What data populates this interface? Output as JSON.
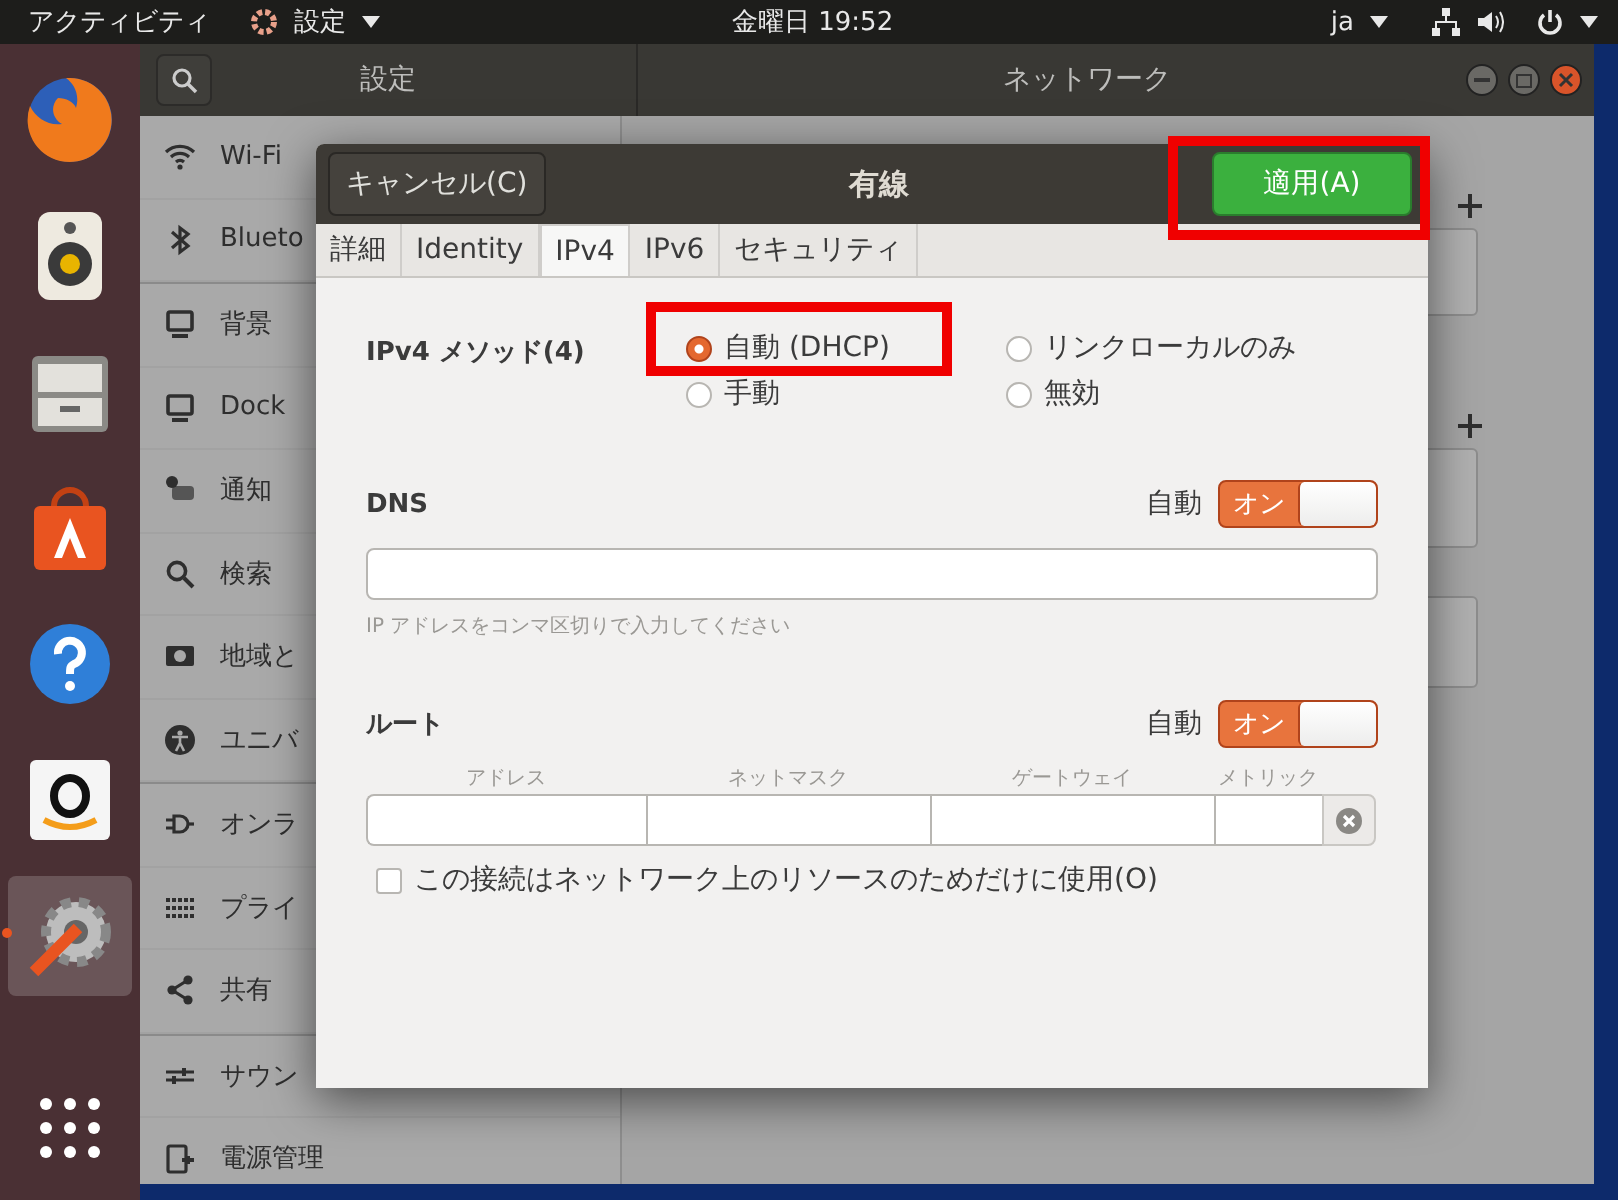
{
  "top_bar": {
    "activities": "アクティビティ",
    "app_menu": "設定",
    "clock": "金曜日 19:52",
    "input_method": "ja"
  },
  "dock": [
    {
      "kind": "firefox",
      "selected": false
    },
    {
      "kind": "speaker",
      "selected": false
    },
    {
      "kind": "files",
      "selected": false
    },
    {
      "kind": "store",
      "selected": false
    },
    {
      "kind": "help",
      "selected": false
    },
    {
      "kind": "amazon",
      "selected": false
    },
    {
      "kind": "settings",
      "selected": true
    },
    {
      "kind": "grid",
      "selected": false
    }
  ],
  "settings_window": {
    "title": "設定",
    "panel_title": "ネットワーク",
    "sidebar": [
      [
        {
          "kind": "wifi",
          "label": "Wi-Fi"
        },
        {
          "kind": "bluetooth",
          "label": "Blueto"
        }
      ],
      [
        {
          "kind": "monitor",
          "label": "背景"
        },
        {
          "kind": "monitor",
          "label": "Dock"
        },
        {
          "kind": "bell",
          "label": "通知"
        },
        {
          "kind": "search",
          "label": "検索"
        },
        {
          "kind": "camera",
          "label": "地域と"
        },
        {
          "kind": "person",
          "label": "ユニバ"
        }
      ],
      [
        {
          "kind": "plug",
          "label": "オンラ"
        },
        {
          "kind": "dots",
          "label": "プライ"
        },
        {
          "kind": "share",
          "label": "共有"
        }
      ],
      [
        {
          "kind": "sliders",
          "label": "サウン"
        },
        {
          "kind": "battery",
          "label": "電源管理"
        }
      ]
    ]
  },
  "dialog": {
    "cancel": "キャンセル(C)",
    "title": "有線",
    "apply": "適用(A)",
    "tabs": [
      {
        "label": "詳細",
        "selected": false
      },
      {
        "label": "Identity",
        "selected": false
      },
      {
        "label": "IPv4",
        "selected": true
      },
      {
        "label": "IPv6",
        "selected": false
      },
      {
        "label": "セキュリティ",
        "selected": false
      }
    ],
    "method": {
      "label": "IPv4 メソッド(4)",
      "options": [
        {
          "label": "自動 (DHCP)",
          "selected": true,
          "highlighted": true
        },
        {
          "label": "手動",
          "selected": false,
          "highlighted": false
        },
        {
          "label": "リンクローカルのみ",
          "selected": false,
          "highlighted": false
        },
        {
          "label": "無効",
          "selected": false,
          "highlighted": false
        }
      ]
    },
    "dns": {
      "label": "DNS",
      "auto_label": "自動",
      "switch": {
        "on": true,
        "label": "オン"
      },
      "hint": "IP アドレスをコンマ区切りで入力してください"
    },
    "routes": {
      "label": "ルート",
      "auto_label": "自動",
      "switch": {
        "on": true,
        "label": "オン"
      },
      "columns": [
        "アドレス",
        "ネットマスク",
        "ゲートウェイ",
        "メトリック"
      ]
    },
    "resources_only": {
      "label": "この接続はネットワーク上のリソースのためだけに使用(O)",
      "checked": false
    }
  }
}
